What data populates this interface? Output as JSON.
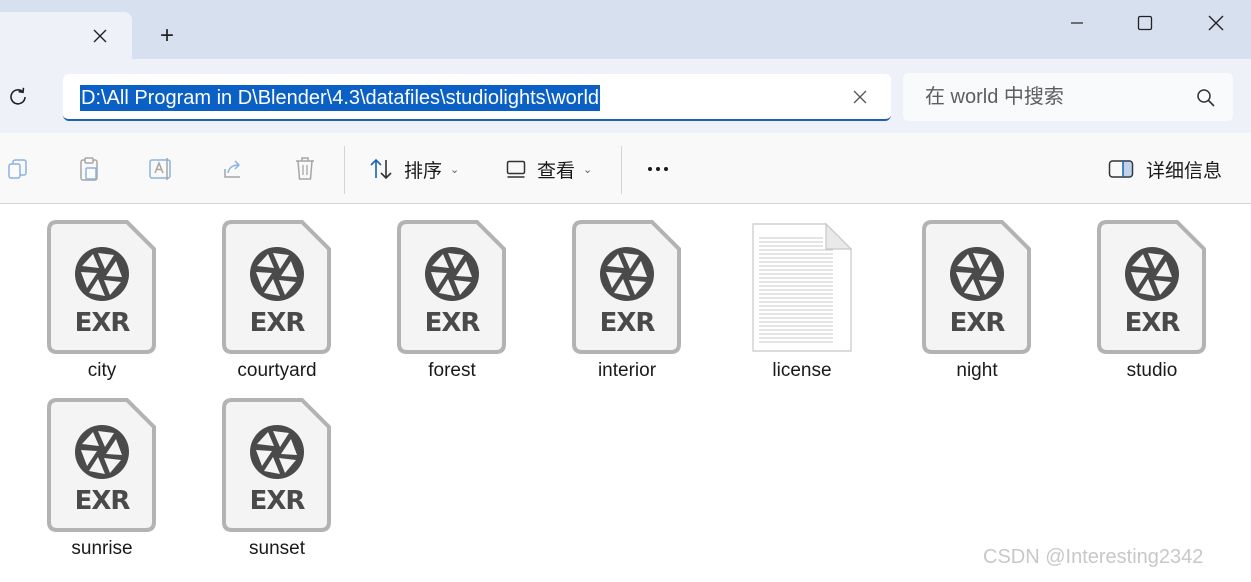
{
  "titlebar": {
    "tab_close_icon": "close-icon",
    "new_tab_label": "+",
    "window_controls": [
      "minimize-icon",
      "maximize-icon",
      "close-icon"
    ]
  },
  "address_bar": {
    "path": "D:\\All Program in D\\Blender\\4.3\\datafiles\\studiolights\\world",
    "selected": true
  },
  "search": {
    "placeholder": "在 world 中搜索"
  },
  "command_bar": {
    "sort_label": "排序",
    "view_label": "查看",
    "details_label": "详细信息",
    "disabled_actions": [
      "copy-icon",
      "paste-icon",
      "rename-icon",
      "share-icon",
      "delete-icon"
    ]
  },
  "files": [
    {
      "name": "city",
      "type": "EXR"
    },
    {
      "name": "courtyard",
      "type": "EXR"
    },
    {
      "name": "forest",
      "type": "EXR"
    },
    {
      "name": "interior",
      "type": "EXR"
    },
    {
      "name": "license",
      "type": "TXT"
    },
    {
      "name": "night",
      "type": "EXR"
    },
    {
      "name": "studio",
      "type": "EXR"
    },
    {
      "name": "sunrise",
      "type": "EXR"
    },
    {
      "name": "sunset",
      "type": "EXR"
    }
  ],
  "watermark": "CSDN @Interesting2342",
  "colors": {
    "accent": "#0a60c4",
    "titlebar": "#d6e0ee",
    "addressbar": "#eef2f8",
    "exr_icon_fill": "#f4f4f4",
    "exr_icon_border": "#b3b3b3",
    "exr_icon_glyph": "#4a4a4a"
  }
}
